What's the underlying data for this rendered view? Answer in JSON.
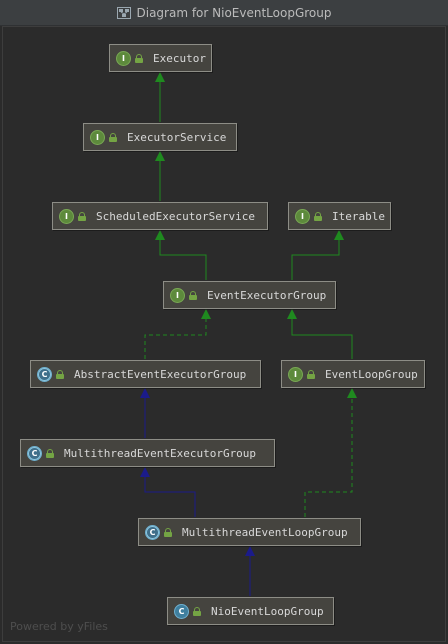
{
  "window": {
    "title": "Diagram for NioEventLoopGroup",
    "icon": "diagram-icon"
  },
  "colors": {
    "background": "#2b2b2b",
    "node_fill": "#45443f",
    "node_border": "#8d8d86",
    "interface_edge": "#1f8a1f",
    "class_edge": "#1b1b8a",
    "text": "#d8d8d8"
  },
  "nodes": {
    "executor": {
      "label": "Executor",
      "kind": "interface",
      "badge": "I"
    },
    "executor_service": {
      "label": "ExecutorService",
      "kind": "interface",
      "badge": "I"
    },
    "scheduled_executor_service": {
      "label": "ScheduledExecutorService",
      "kind": "interface",
      "badge": "I"
    },
    "iterable": {
      "label": "Iterable",
      "kind": "interface",
      "badge": "I"
    },
    "event_executor_group": {
      "label": "EventExecutorGroup",
      "kind": "interface",
      "badge": "I"
    },
    "abstract_event_executor_group": {
      "label": "AbstractEventExecutorGroup",
      "kind": "abstract-class",
      "badge": "C"
    },
    "event_loop_group": {
      "label": "EventLoopGroup",
      "kind": "interface",
      "badge": "I"
    },
    "multithread_event_executor_group": {
      "label": "MultithreadEventExecutorGroup",
      "kind": "abstract-class",
      "badge": "C"
    },
    "multithread_event_loop_group": {
      "label": "MultithreadEventLoopGroup",
      "kind": "abstract-class",
      "badge": "C"
    },
    "nio_event_loop_group": {
      "label": "NioEventLoopGroup",
      "kind": "class",
      "badge": "C"
    }
  },
  "edges": [
    {
      "from": "ExecutorService",
      "to": "Executor",
      "type": "extends-interface"
    },
    {
      "from": "ScheduledExecutorService",
      "to": "ExecutorService",
      "type": "extends-interface"
    },
    {
      "from": "EventExecutorGroup",
      "to": "ScheduledExecutorService",
      "type": "extends-interface"
    },
    {
      "from": "EventExecutorGroup",
      "to": "Iterable",
      "type": "extends-interface"
    },
    {
      "from": "AbstractEventExecutorGroup",
      "to": "EventExecutorGroup",
      "type": "implements"
    },
    {
      "from": "EventLoopGroup",
      "to": "EventExecutorGroup",
      "type": "extends-interface"
    },
    {
      "from": "MultithreadEventExecutorGroup",
      "to": "AbstractEventExecutorGroup",
      "type": "extends-class"
    },
    {
      "from": "MultithreadEventLoopGroup",
      "to": "MultithreadEventExecutorGroup",
      "type": "extends-class"
    },
    {
      "from": "MultithreadEventLoopGroup",
      "to": "EventLoopGroup",
      "type": "implements"
    },
    {
      "from": "NioEventLoopGroup",
      "to": "MultithreadEventLoopGroup",
      "type": "extends-class"
    }
  ],
  "footer": {
    "text": "Powered by yFiles"
  }
}
